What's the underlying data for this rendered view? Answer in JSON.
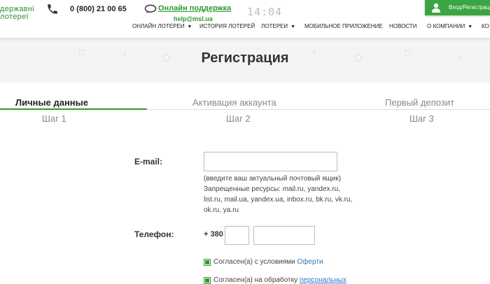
{
  "header": {
    "logo_line1": "державні",
    "logo_line2": "лотереї",
    "phone": "0 (800) 21 00 65",
    "support_label": "Онлайн поддержка",
    "support_email": "help@msl.ua",
    "clock": "14:04",
    "login_label": "Вход/Регистрация",
    "accent_color": "#2e9a2e"
  },
  "nav": {
    "items": [
      {
        "label": "ОНЛАЙН ЛОТЕРЕИ",
        "has_dropdown": true
      },
      {
        "label": "ИСТОРИЯ ЛОТЕРЕЙ",
        "has_dropdown": false
      },
      {
        "label": "ЛОТЕРЕИ",
        "has_dropdown": true
      },
      {
        "label": "МОБИЛЬНОЕ ПРИЛОЖЕНИЕ",
        "has_dropdown": false
      },
      {
        "label": "НОВОСТИ",
        "has_dropdown": false
      },
      {
        "label": "О КОМПАНИИ",
        "has_dropdown": true
      },
      {
        "label": "КО",
        "has_dropdown": false
      }
    ]
  },
  "page": {
    "title": "Регистрация"
  },
  "steps": [
    {
      "title": "Личные данные",
      "number": "Шаг 1",
      "active": true
    },
    {
      "title": "Активация аккаунта",
      "number": "Шаг 2",
      "active": false
    },
    {
      "title": "Первый депозит",
      "number": "Шаг 3",
      "active": false
    }
  ],
  "form": {
    "email_label": "E-mail:",
    "email_value": "",
    "email_hint1": "(введите ваш актуальный почтовый ящик)",
    "email_hint2": "Запрещенные ресурсы: mail.ru, yandex.ru, list.ru, mail.ua, yandex.ua, inbox.ru, bk.ru, vk.ru, ok.ru, ya.ru",
    "phone_label": "Телефон:",
    "phone_prefix": "+ 380",
    "phone_code": "",
    "phone_number": "",
    "agree1_text": "Согласен(а) с условиями ",
    "agree1_link": "Оферти",
    "agree2_text": "Согласен(а) на обработку ",
    "agree2_link": "персональных"
  }
}
